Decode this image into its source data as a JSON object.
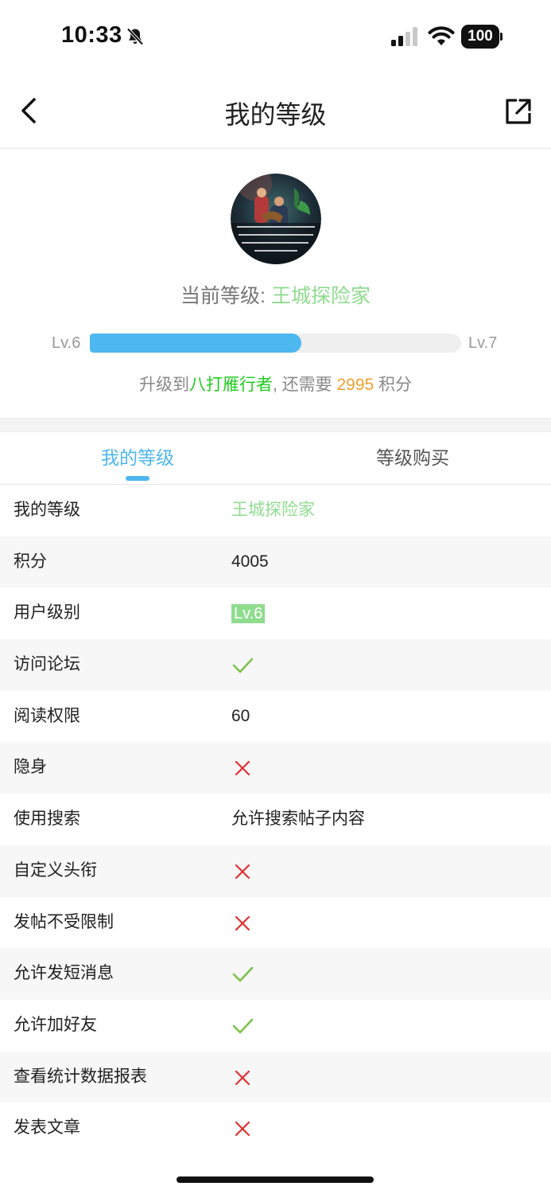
{
  "status_bar": {
    "time": "10:33",
    "battery": "100"
  },
  "nav": {
    "title": "我的等级"
  },
  "header": {
    "current_level_label": "当前等级: ",
    "current_level_value": "王城探险家",
    "lv_current": "Lv.6",
    "lv_next": "Lv.7",
    "progress": 0.57,
    "upgrade_prefix": "升级到",
    "upgrade_next": "八打雁行者",
    "upgrade_mid": ", 还需要 ",
    "upgrade_points": "2995",
    "upgrade_suffix": " 积分"
  },
  "tabs": [
    "我的等级",
    "等级购买"
  ],
  "rows": [
    {
      "label": "我的等级",
      "type": "green-text",
      "value": "王城探险家"
    },
    {
      "label": "积分",
      "type": "text",
      "value": "4005"
    },
    {
      "label": "用户级别",
      "type": "badge",
      "value": "Lv.6"
    },
    {
      "label": "访问论坛",
      "type": "check"
    },
    {
      "label": "阅读权限",
      "type": "text",
      "value": "60"
    },
    {
      "label": "隐身",
      "type": "cross"
    },
    {
      "label": "使用搜索",
      "type": "text",
      "value": "允许搜索帖子内容"
    },
    {
      "label": "自定义头衔",
      "type": "cross"
    },
    {
      "label": "发帖不受限制",
      "type": "cross"
    },
    {
      "label": "允许发短消息",
      "type": "check"
    },
    {
      "label": "允许加好友",
      "type": "check"
    },
    {
      "label": "查看统计数据报表",
      "type": "cross"
    },
    {
      "label": "发表文章",
      "type": "cross"
    }
  ],
  "colors": {
    "accent": "#4db7ef",
    "level_green": "#8fdc8f",
    "check": "#7cc24a",
    "cross": "#e03030",
    "points": "#f0a030"
  }
}
